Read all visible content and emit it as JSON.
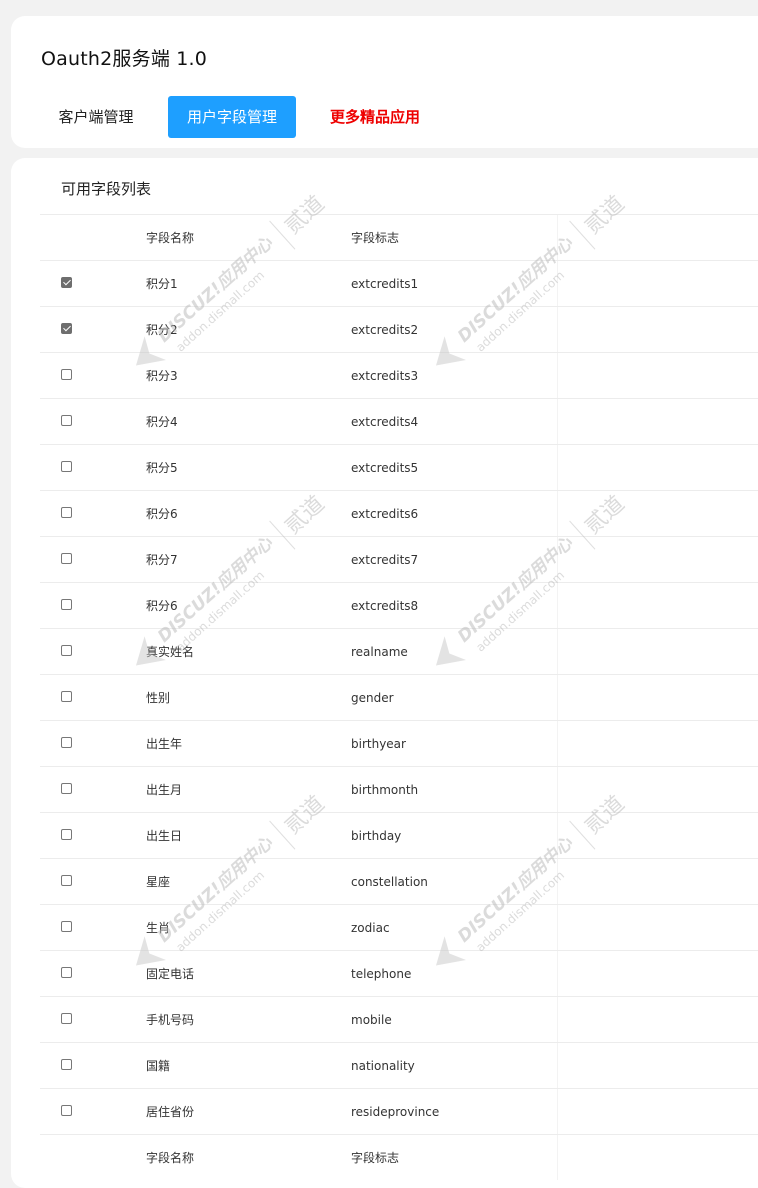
{
  "app": {
    "title": "Oauth2服务端 1.0"
  },
  "tabs": [
    {
      "label": "客户端管理",
      "active": false
    },
    {
      "label": "用户字段管理",
      "active": true
    },
    {
      "label": "更多精品应用",
      "active": false
    }
  ],
  "section": {
    "title": "可用字段列表"
  },
  "table": {
    "headers": {
      "name": "字段名称",
      "key": "字段标志"
    },
    "rows": [
      {
        "checked": true,
        "name": "积分1",
        "key": "extcredits1"
      },
      {
        "checked": true,
        "name": "积分2",
        "key": "extcredits2"
      },
      {
        "checked": false,
        "name": "积分3",
        "key": "extcredits3"
      },
      {
        "checked": false,
        "name": "积分4",
        "key": "extcredits4"
      },
      {
        "checked": false,
        "name": "积分5",
        "key": "extcredits5"
      },
      {
        "checked": false,
        "name": "积分6",
        "key": "extcredits6"
      },
      {
        "checked": false,
        "name": "积分7",
        "key": "extcredits7"
      },
      {
        "checked": false,
        "name": "积分6",
        "key": "extcredits8"
      },
      {
        "checked": false,
        "name": "真实姓名",
        "key": "realname"
      },
      {
        "checked": false,
        "name": "性别",
        "key": "gender"
      },
      {
        "checked": false,
        "name": "出生年",
        "key": "birthyear"
      },
      {
        "checked": false,
        "name": "出生月",
        "key": "birthmonth"
      },
      {
        "checked": false,
        "name": "出生日",
        "key": "birthday"
      },
      {
        "checked": false,
        "name": "星座",
        "key": "constellation"
      },
      {
        "checked": false,
        "name": "生肖",
        "key": "zodiac"
      },
      {
        "checked": false,
        "name": "固定电话",
        "key": "telephone"
      },
      {
        "checked": false,
        "name": "手机号码",
        "key": "mobile"
      },
      {
        "checked": false,
        "name": "国籍",
        "key": "nationality"
      },
      {
        "checked": false,
        "name": "居住省份",
        "key": "resideprovince"
      }
    ],
    "footer": {
      "name": "字段名称",
      "key": "字段标志"
    }
  },
  "watermark": {
    "line1": "DISCUZ!应用中心",
    "line2": "addon.dismall.com",
    "mark": "贰道"
  },
  "colors": {
    "accent": "#1e9fff",
    "promo": "#ee0000"
  }
}
